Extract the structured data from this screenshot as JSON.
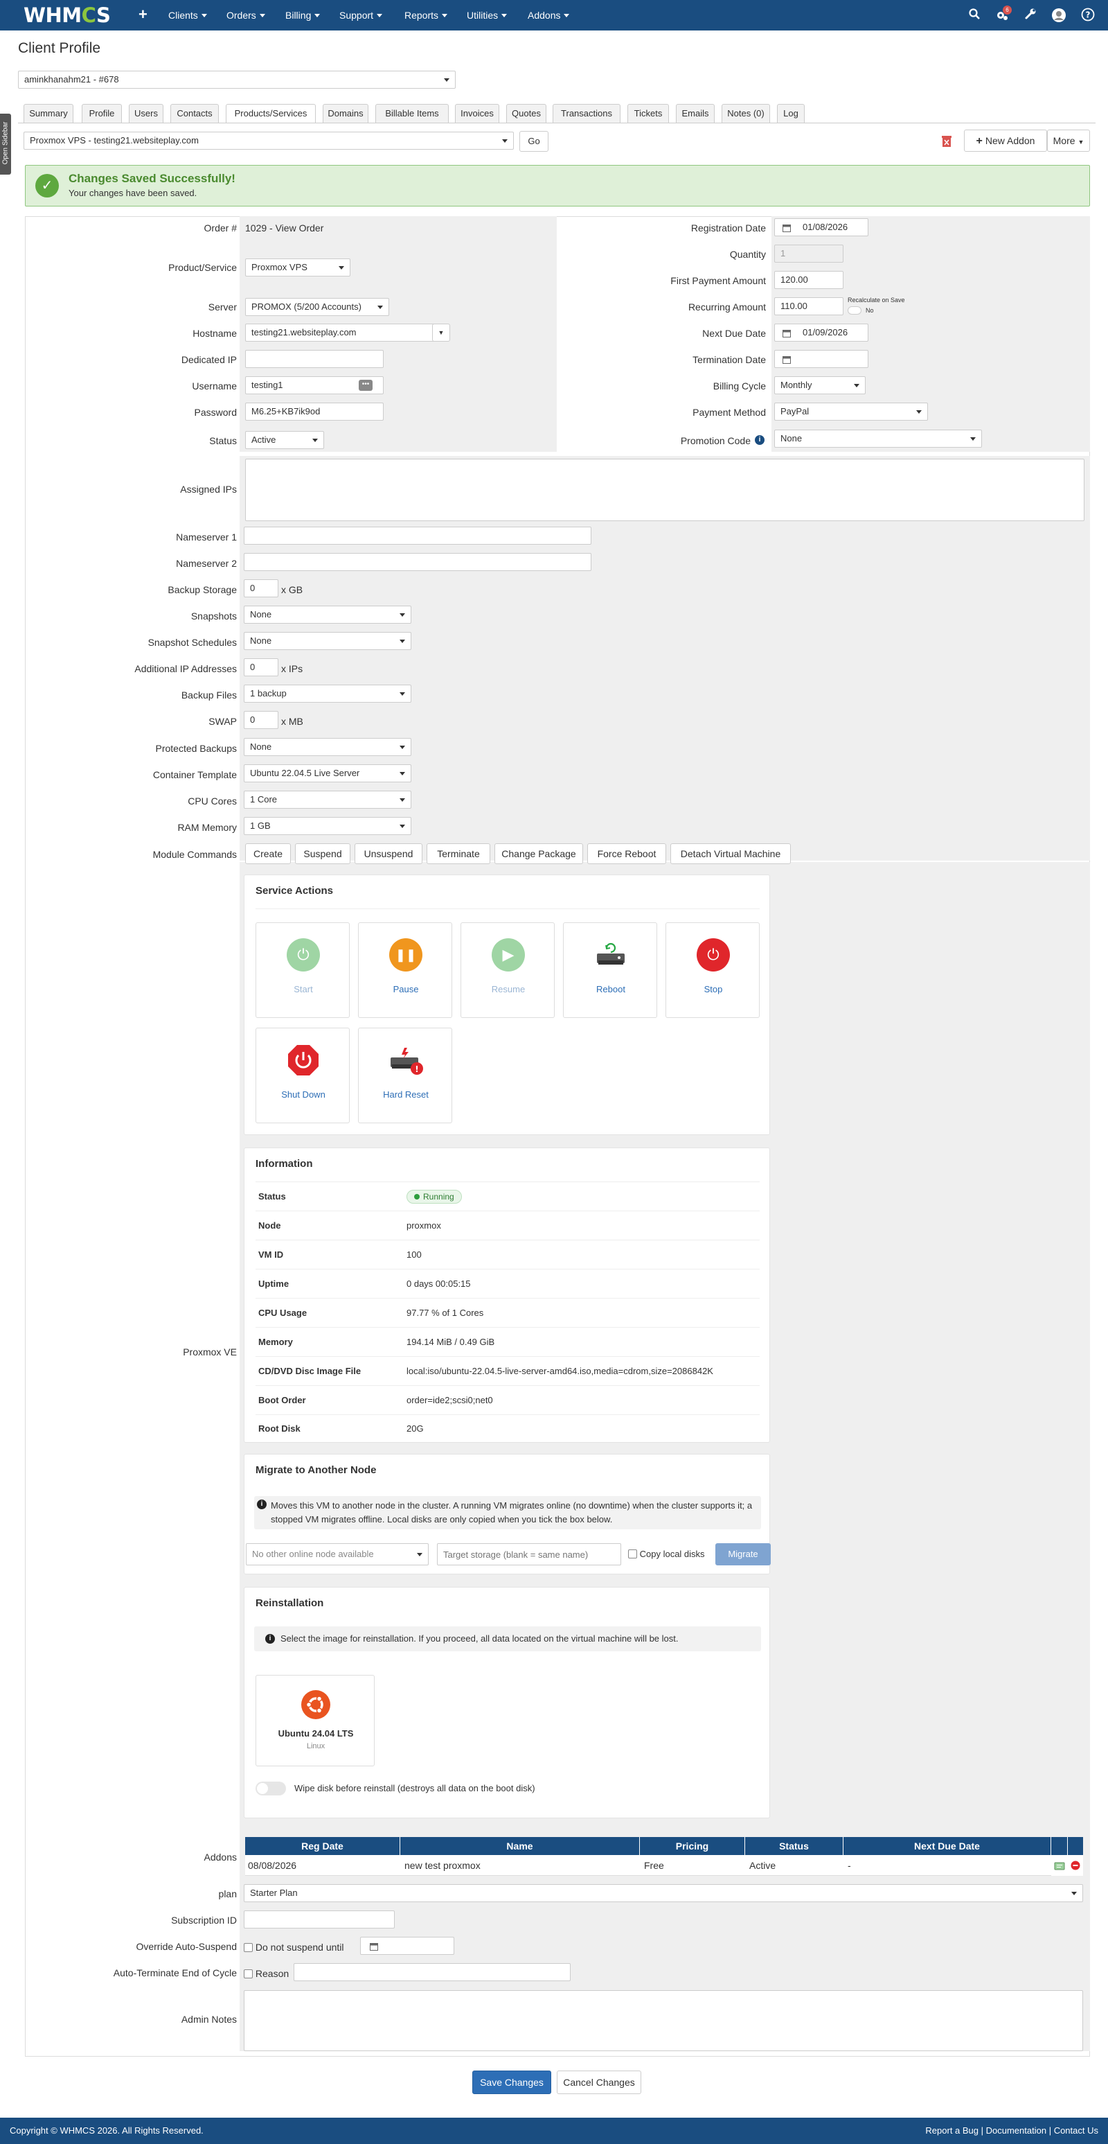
{
  "nav": {
    "logo": "WHMCS",
    "items": [
      "Clients",
      "Orders",
      "Billing",
      "Support",
      "Reports",
      "Utilities",
      "Addons"
    ],
    "notification_count": "6"
  },
  "page": {
    "title": "Client Profile",
    "client_select": "aminkhanahm21 - #678",
    "sidebar_toggle": "Open Sidebar"
  },
  "tabs": [
    "Summary",
    "Profile",
    "Users",
    "Contacts",
    "Products/Services",
    "Domains",
    "Billable Items",
    "Invoices",
    "Quotes",
    "Transactions",
    "Tickets",
    "Emails",
    "Notes (0)",
    "Log"
  ],
  "service_bar": {
    "service_select": "Proxmox VPS - testing21.websiteplay.com",
    "go": "Go",
    "new_addon": "New Addon",
    "more": "More"
  },
  "alert": {
    "title": "Changes Saved Successfully!",
    "text": "Your changes have been saved."
  },
  "left_fields": {
    "order_label": "Order #",
    "order_value": "1029 - View Order",
    "product_label": "Product/Service",
    "product_value": "Proxmox VPS",
    "server_label": "Server",
    "server_value": "PROMOX (5/200 Accounts)",
    "hostname_label": "Hostname",
    "hostname_value": "testing21.websiteplay.com",
    "dedicated_ip_label": "Dedicated IP",
    "dedicated_ip_value": "",
    "username_label": "Username",
    "username_value": "testing1",
    "password_label": "Password",
    "password_value": "M6.25+KB7ik9od",
    "status_label": "Status",
    "status_value": "Active"
  },
  "right_fields": {
    "reg_date_label": "Registration Date",
    "reg_date_value": "01/08/2026",
    "quantity_label": "Quantity",
    "quantity_value": "1",
    "first_payment_label": "First Payment Amount",
    "first_payment_value": "120.00",
    "recurring_label": "Recurring Amount",
    "recurring_value": "110.00",
    "recalc_label": "Recalculate on Save",
    "recalc_value": "No",
    "next_due_label": "Next Due Date",
    "next_due_value": "01/09/2026",
    "termination_label": "Termination Date",
    "termination_value": "",
    "billing_cycle_label": "Billing Cycle",
    "billing_cycle_value": "Monthly",
    "payment_method_label": "Payment Method",
    "payment_method_value": "PayPal",
    "promo_label": "Promotion Code",
    "promo_value": "None"
  },
  "config": {
    "assigned_ips_label": "Assigned IPs",
    "ns1_label": "Nameserver 1",
    "ns2_label": "Nameserver 2",
    "backup_storage_label": "Backup Storage",
    "backup_storage_value": "0",
    "backup_storage_unit": "x GB",
    "snapshots_label": "Snapshots",
    "snapshots_value": "None",
    "snapshot_sched_label": "Snapshot Schedules",
    "snapshot_sched_value": "None",
    "add_ip_label": "Additional IP Addresses",
    "add_ip_value": "0",
    "add_ip_unit": "x IPs",
    "backup_files_label": "Backup Files",
    "backup_files_value": "1 backup",
    "swap_label": "SWAP",
    "swap_value": "0",
    "swap_unit": "x MB",
    "protected_label": "Protected Backups",
    "protected_value": "None",
    "template_label": "Container Template",
    "template_value": "Ubuntu 22.04.5 Live Server",
    "cpu_label": "CPU Cores",
    "cpu_value": "1 Core",
    "ram_label": "RAM Memory",
    "ram_value": "1 GB",
    "module_label": "Module Commands",
    "module_buttons": [
      "Create",
      "Suspend",
      "Unsuspend",
      "Terminate",
      "Change Package",
      "Force Reboot",
      "Detach Virtual Machine"
    ]
  },
  "proxmox": {
    "label": "Proxmox VE",
    "service_actions_title": "Service Actions",
    "actions": [
      "Start",
      "Pause",
      "Resume",
      "Reboot",
      "Stop",
      "Shut Down",
      "Hard Reset"
    ],
    "info_title": "Information",
    "info": [
      {
        "k": "Status",
        "v": "Running"
      },
      {
        "k": "Node",
        "v": "proxmox"
      },
      {
        "k": "VM ID",
        "v": "100"
      },
      {
        "k": "Uptime",
        "v": "0 days 00:05:15"
      },
      {
        "k": "CPU Usage",
        "v": "97.77 % of 1 Cores"
      },
      {
        "k": "Memory",
        "v": "194.14 MiB / 0.49 GiB"
      },
      {
        "k": "CD/DVD Disc Image File",
        "v": "local:iso/ubuntu-22.04.5-live-server-amd64.iso,media=cdrom,size=2086842K"
      },
      {
        "k": "Boot Order",
        "v": "order=ide2;scsi0;net0"
      },
      {
        "k": "Root Disk",
        "v": "20G"
      }
    ],
    "migrate_title": "Migrate to Another Node",
    "migrate_text": "Moves this VM to another node in the cluster. A running VM migrates online (no downtime) when the cluster supports it; a stopped VM migrates offline. Local disks are only copied when you tick the box below.",
    "migrate_node": "No other online node available",
    "migrate_storage_placeholder": "Target storage (blank = same name)",
    "migrate_copy": "Copy local disks",
    "migrate_btn": "Migrate",
    "reinstall_title": "Reinstallation",
    "reinstall_text": "Select the image for reinstallation. If you proceed, all data located on the virtual machine will be lost.",
    "image_name": "Ubuntu 24.04 LTS",
    "image_os": "Linux",
    "wipe_text": "Wipe disk before reinstall (destroys all data on the boot disk)"
  },
  "addons": {
    "label": "Addons",
    "headers": [
      "Reg Date",
      "Name",
      "Pricing",
      "Status",
      "Next Due Date"
    ],
    "row": [
      "08/08/2026",
      "new test proxmox",
      "Free",
      "Active",
      "-"
    ]
  },
  "bottom": {
    "plan_label": "plan",
    "plan_value": "Starter Plan",
    "sub_label": "Subscription ID",
    "override_label": "Override Auto-Suspend",
    "override_text": "Do not suspend until",
    "autoterm_label": "Auto-Terminate End of Cycle",
    "autoterm_text": "Reason",
    "notes_label": "Admin Notes",
    "save": "Save Changes",
    "cancel": "Cancel Changes"
  },
  "footer": {
    "copyright": "Copyright © WHMCS 2026. All Rights Reserved.",
    "links": [
      "Report a Bug",
      "Documentation",
      "Contact Us"
    ]
  },
  "colors": {
    "nav": "#1a4d80",
    "accent": "#2d6eb6",
    "success": "#5ea83f",
    "pause": "#f0961e",
    "stop": "#e0262b"
  }
}
